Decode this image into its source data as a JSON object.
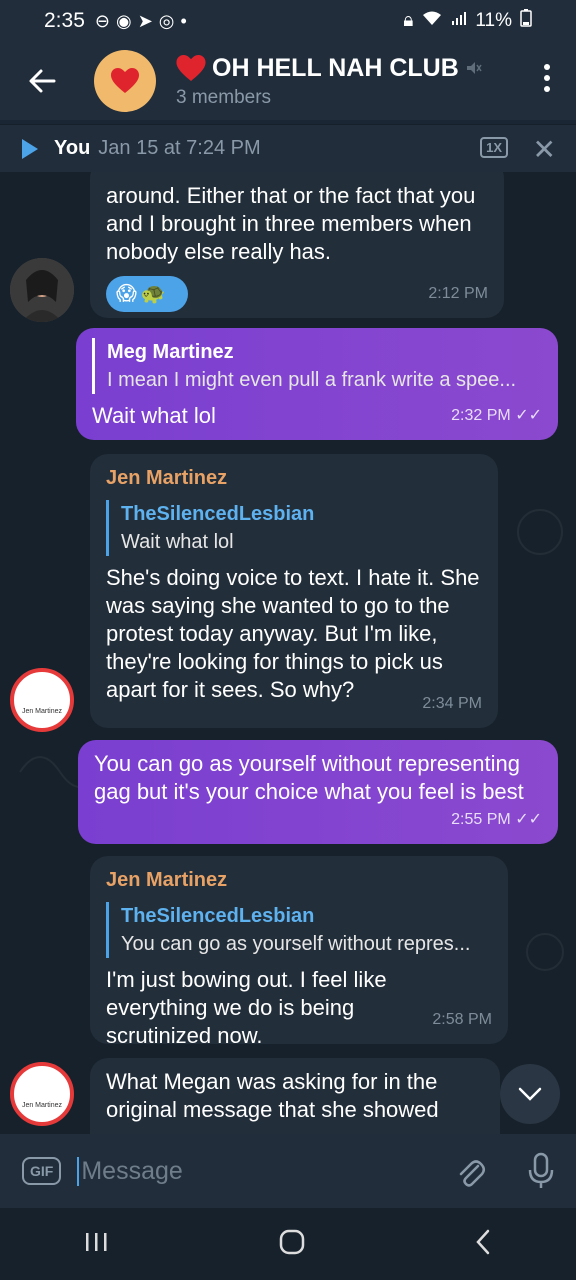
{
  "status_bar": {
    "time": "2:35",
    "battery": "11%"
  },
  "header": {
    "title": "OH HELL NAH CLUB",
    "subtitle": "3 members"
  },
  "player": {
    "who": "You",
    "when": "Jan 15 at 7:24 PM",
    "speed": "1X"
  },
  "messages": [
    {
      "text": "around. Either that or the fact that you and I brought in three members when nobody else really has.",
      "time": "2:12 PM",
      "reactions": [
        "😱",
        "🐢"
      ]
    },
    {
      "reply_name": "Meg Martinez",
      "reply_text": "I mean I might even pull a frank write a spee...",
      "text": "Wait what lol",
      "time": "2:32 PM"
    },
    {
      "sender": "Jen Martinez",
      "reply_name": "TheSilencedLesbian",
      "reply_text": "Wait what lol",
      "text": "She's doing voice to text. I hate it. She was saying she wanted to go to the protest today anyway. But I'm like, they're looking for things to pick us apart for it sees. So why?",
      "time": "2:34 PM"
    },
    {
      "text": "You can go as yourself without representing gag but it's your choice what you feel is best",
      "time": "2:55 PM"
    },
    {
      "sender": "Jen Martinez",
      "reply_name": "TheSilencedLesbian",
      "reply_text": "You can go as yourself without repres...",
      "text": "I'm just bowing out. I feel like everything we do is being scrutinized now.",
      "time": "2:58 PM"
    },
    {
      "text": "What Megan was asking for in the original message that she showed"
    }
  ],
  "avatar_label": "Jen Martinez",
  "composer": {
    "gif_label": "GIF",
    "placeholder": "Message"
  },
  "colors": {
    "background": "#17212b",
    "header": "#212d3b",
    "incoming": "#222e3a",
    "outgoing": "#8b49cf",
    "accent": "#4da3e8",
    "sender_name": "#e8a266"
  }
}
